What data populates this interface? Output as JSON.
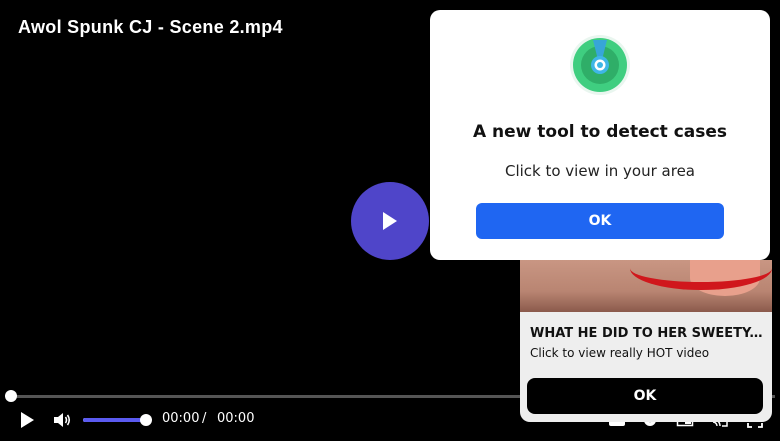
{
  "video": {
    "title": "Awol Spunk CJ - Scene 2.mp4"
  },
  "player": {
    "current_time": "00:00",
    "separator": "/",
    "duration": "00:00",
    "progress": 0,
    "volume": 1.0,
    "icons": {
      "big_play": "play-icon",
      "play": "play-icon",
      "volume": "volume-icon",
      "captions": "captions-icon",
      "settings": "gear-icon",
      "pip": "picture-in-picture-icon",
      "cast": "cast-icon",
      "fullscreen": "fullscreen-icon"
    },
    "colors": {
      "accent": "#4f45c9",
      "volume": "#5b5bf0"
    }
  },
  "popup": {
    "heading": "A new tool to detect cases",
    "subtext": "Click to view in your area",
    "ok_label": "OK",
    "icon": "radar-icon",
    "colors": {
      "button": "#1f66f2",
      "icon_green": "#3fce80"
    }
  },
  "ad": {
    "title": "WHAT HE DID TO HER SWEETY-P...",
    "subtext": "Click to view really HOT video",
    "ok_label": "OK"
  }
}
